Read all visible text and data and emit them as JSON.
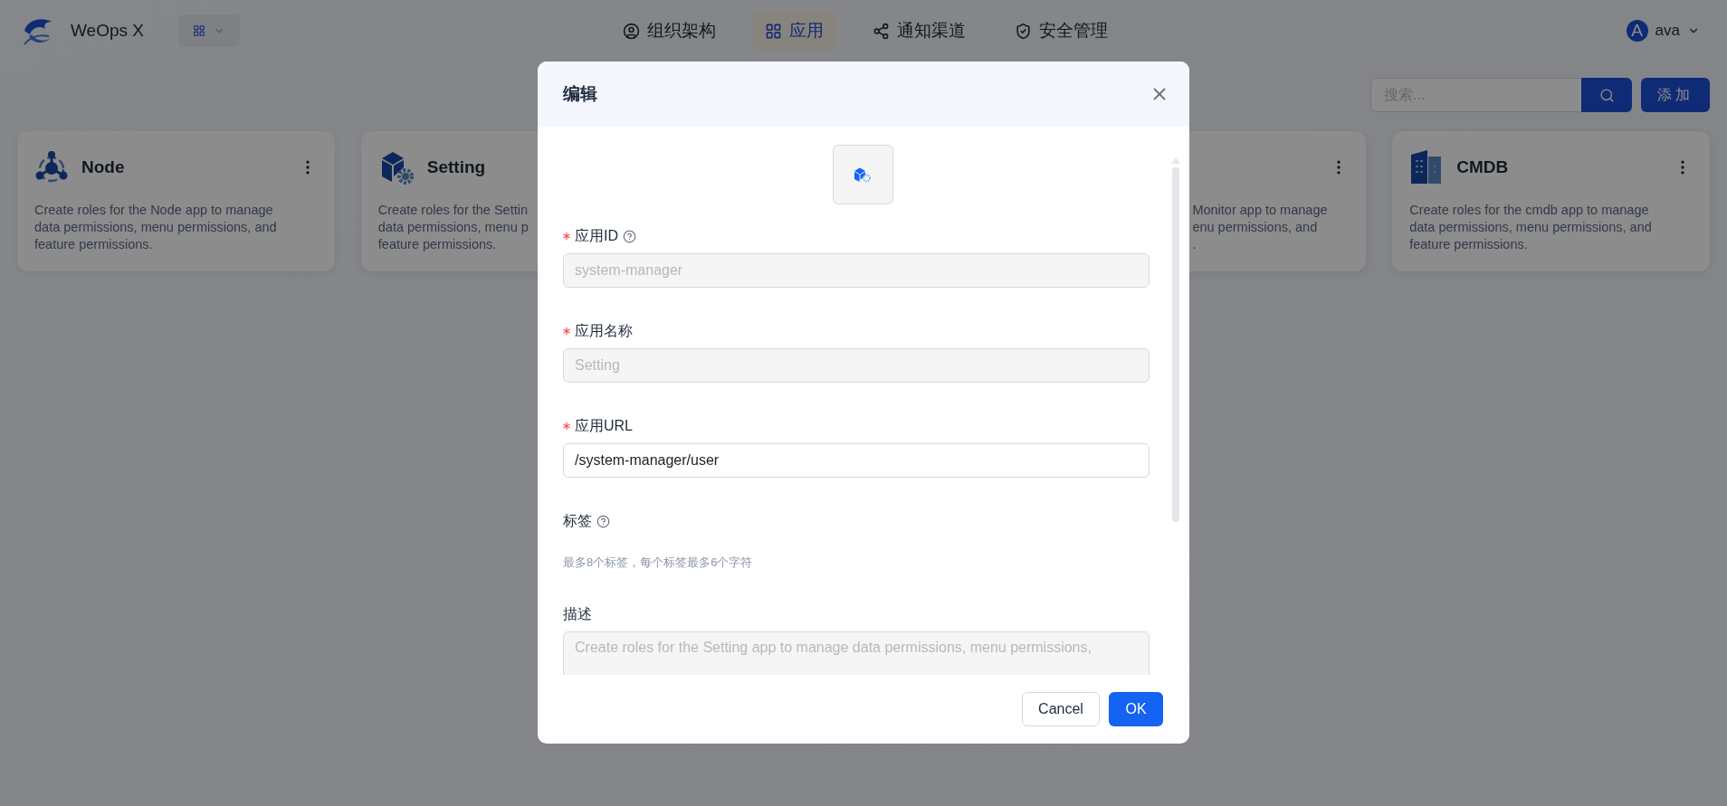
{
  "header": {
    "logo_text": "WeOps X",
    "nav": [
      {
        "label": "组织架构",
        "selected": false
      },
      {
        "label": "应用",
        "selected": true
      },
      {
        "label": "通知渠道",
        "selected": false
      },
      {
        "label": "安全管理",
        "selected": false
      }
    ],
    "user": {
      "avatar": "A",
      "name": "ava"
    }
  },
  "toolbar": {
    "search": {
      "placeholder": "搜索..."
    },
    "add_button": "添加"
  },
  "cards": [
    {
      "kind": "full",
      "title": "Node",
      "description_lines": [
        "Create roles for the Node app to manage",
        "data permissions, menu permissions, and",
        "feature permissions."
      ]
    },
    {
      "kind": "full",
      "title": "Setting",
      "description_lines": [
        "Create roles for the Settin",
        "data permissions, menu p",
        "feature permissions."
      ]
    },
    {
      "kind": "covered",
      "description_lines": [
        "Monitor app to manage",
        "enu permissions, and",
        "."
      ]
    },
    {
      "kind": "full",
      "title": "CMDB",
      "description_lines": [
        "Create roles for the cmdb app to manage",
        "data permissions, menu permissions, and",
        "feature permissions."
      ]
    }
  ],
  "modal": {
    "title": "编辑",
    "fields": [
      {
        "kind": "input",
        "label": "应用ID",
        "required": true,
        "help": true,
        "value": "system-manager",
        "disabled": true
      },
      {
        "kind": "input",
        "label": "应用名称",
        "required": true,
        "help": false,
        "value": "Setting",
        "disabled": true
      },
      {
        "kind": "input",
        "label": "应用URL",
        "required": true,
        "help": false,
        "value": "/system-manager/user",
        "disabled": false
      },
      {
        "kind": "tags",
        "label": "标签",
        "required": false,
        "help": true,
        "hint": "最多8个标签，每个标签最多6个字符"
      },
      {
        "kind": "textarea",
        "label": "描述",
        "required": false,
        "help": false,
        "value": "Create roles for the Setting app to manage data permissions, menu permissions,",
        "disabled": true
      }
    ],
    "buttons": {
      "cancel": "Cancel",
      "ok": "OK"
    }
  }
}
